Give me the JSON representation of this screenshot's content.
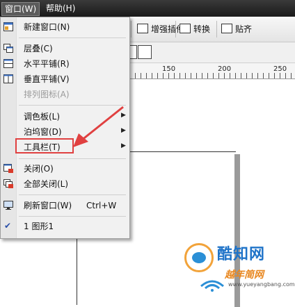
{
  "menubar": {
    "items": [
      {
        "label": "窗口(W)"
      },
      {
        "label": "帮助(H)"
      }
    ]
  },
  "toolbar": {
    "buttons": [
      {
        "label": "增强插件",
        "icon": "plugin-icon"
      },
      {
        "label": "转换",
        "icon": "convert-icon"
      },
      {
        "label": "贴齐",
        "icon": "snap-icon"
      }
    ]
  },
  "ruler": {
    "labels": [
      "150",
      "200",
      "250"
    ]
  },
  "window_menu": {
    "items": [
      {
        "label": "新建窗口(N)",
        "icon": "new-window-icon",
        "enabled": true
      },
      {
        "label": "层叠(C)",
        "icon": "cascade-icon",
        "enabled": true
      },
      {
        "label": "水平平铺(R)",
        "icon": "tile-horizontal-icon",
        "enabled": true
      },
      {
        "label": "垂直平铺(V)",
        "icon": "tile-vertical-icon",
        "enabled": true
      },
      {
        "label": "排列图标(A)",
        "enabled": false
      },
      {
        "label": "调色板(L)",
        "submenu": true,
        "enabled": true
      },
      {
        "label": "泊坞窗(D)",
        "submenu": true,
        "enabled": true
      },
      {
        "label": "工具栏(T)",
        "submenu": true,
        "enabled": true,
        "highlighted": true
      },
      {
        "label": "关闭(O)",
        "icon": "close-window-icon",
        "enabled": true
      },
      {
        "label": "全部关闭(L)",
        "icon": "close-all-icon",
        "enabled": true
      },
      {
        "label": "刷新窗口(W)",
        "icon": "refresh-icon",
        "shortcut": "Ctrl+W",
        "enabled": true
      },
      {
        "label": "1 图形1",
        "checked": true,
        "enabled": true
      }
    ]
  },
  "annotation": {
    "color": "#e04040"
  },
  "watermark": {
    "title": "酷知网",
    "subtitle": "越年简网",
    "url": "www.yueyangbang.com"
  },
  "colors": {
    "menubar": "#1f1f1f",
    "menu_bg": "#f1f1f1",
    "highlight_border": "#e04040"
  }
}
